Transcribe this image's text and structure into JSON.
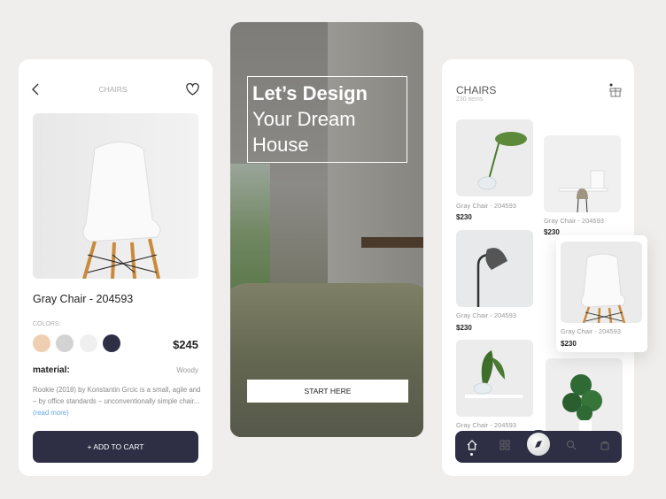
{
  "detail": {
    "back_icon": "chevron-left-icon",
    "title": "CHAIRS",
    "fav_icon": "heart-icon",
    "product_name": "Gray Chair - 204593",
    "colors_label": "COLORS:",
    "colors": [
      "#efcfb1",
      "#d3d3d3",
      "#efefef",
      "#2d2f45"
    ],
    "price": "$245",
    "material_label": "material:",
    "material_value": "Woody",
    "description": "Rookie (2018) by Konstantin Grcic is a small, agile and – by office standards  –  unconventionally simple chair...",
    "read_more": "(read more)",
    "add_to_cart": "+ ADD TO CART"
  },
  "hero": {
    "line1": "Let’s Design",
    "line2": "Your Dream",
    "line3": "House",
    "cta": "START HERE"
  },
  "catalog": {
    "title": "CHAIRS",
    "count": "230 items",
    "gift_icon": "gift-icon",
    "items": [
      {
        "name": "Gray Chair - 204593",
        "price": "$230"
      },
      {
        "name": "Gray Chair - 204593",
        "price": "$230"
      },
      {
        "name": "Gray Chair - 204593",
        "price": "$230"
      },
      {
        "name": "Gray Chair - 204593",
        "price": "$230"
      },
      {
        "name": "Gray Chair - 204593"
      }
    ],
    "nav": [
      "home-icon",
      "grid-icon",
      "compass-icon",
      "search-icon",
      "bag-icon"
    ]
  },
  "accent": "#2e2f45"
}
